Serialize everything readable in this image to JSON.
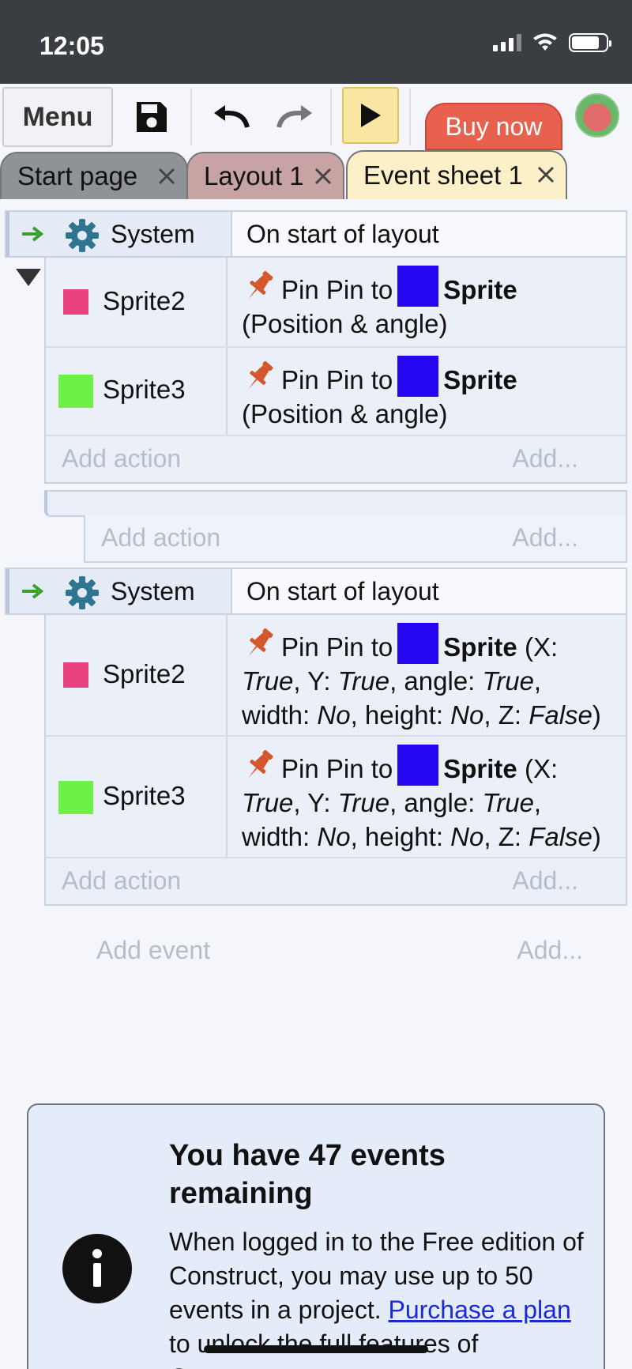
{
  "status_bar": {
    "time": "12:05"
  },
  "toolbar": {
    "menu_label": "Menu",
    "buy_label": "Buy now",
    "icons": [
      "save-icon",
      "undo-icon",
      "redo-icon",
      "play-icon"
    ]
  },
  "tabs": [
    {
      "label": "Start page",
      "color": "#8f9296"
    },
    {
      "label": "Layout 1",
      "color": "#c8a3a3"
    },
    {
      "label": "Event sheet 1",
      "color": "#fbf0c8"
    }
  ],
  "events": [
    {
      "condition_object": "System",
      "condition": "On start of layout",
      "actions": [
        {
          "object": "Sprite2",
          "swatch": "#e8407f",
          "prefix": "Pin Pin to",
          "target": "Sprite",
          "line2": "(Position & angle)"
        },
        {
          "object": "Sprite3",
          "swatch": "#6ff047",
          "prefix": "Pin Pin to",
          "target": "Sprite",
          "line2": "(Position & angle)"
        }
      ],
      "add_action": "Add action",
      "add_more": "Add..."
    },
    {
      "add_action": "Add action",
      "add_more": "Add..."
    },
    {
      "condition_object": "System",
      "condition": "On start of layout",
      "actions": [
        {
          "object": "Sprite2",
          "swatch": "#e8407f",
          "prefix": "Pin Pin to",
          "target": "Sprite",
          "params": {
            "x_label": "(X:",
            "x_value": "True",
            "y_label": ", Y:",
            "y_value": "True",
            "angle_label": ", angle:",
            "angle_value": "True",
            "width_label": "width:",
            "width_value": "No",
            "height_label": ", height:",
            "height_value": "No",
            "z_label": ", Z:",
            "z_value": "False",
            "close": ")"
          }
        },
        {
          "object": "Sprite3",
          "swatch": "#6ff047",
          "prefix": "Pin Pin to",
          "target": "Sprite",
          "params": {
            "x_label": "(X:",
            "x_value": "True",
            "y_label": ", Y:",
            "y_value": "True",
            "angle_label": ", angle:",
            "angle_value": "True",
            "width_label": "width:",
            "width_value": "No",
            "height_label": ", height:",
            "height_value": "No",
            "z_label": ", Z:",
            "z_value": "False",
            "close": ")"
          }
        }
      ],
      "add_action": "Add action",
      "add_more": "Add..."
    }
  ],
  "add_event": {
    "label": "Add event",
    "more": "Add..."
  },
  "notice": {
    "title": "You have 47 events remaining",
    "body_1": "When logged in to the Free edition of Construct, you may use up to 50 events in a project.",
    "link": "Purchase a plan",
    "body_2": " to unlock the full features of Construct."
  },
  "colors": {
    "sprite_target": "#2406f0",
    "pin": "#d4562b",
    "gear": "#2f7590",
    "arrow": "#3aa02a",
    "buy": "#e8614e"
  }
}
